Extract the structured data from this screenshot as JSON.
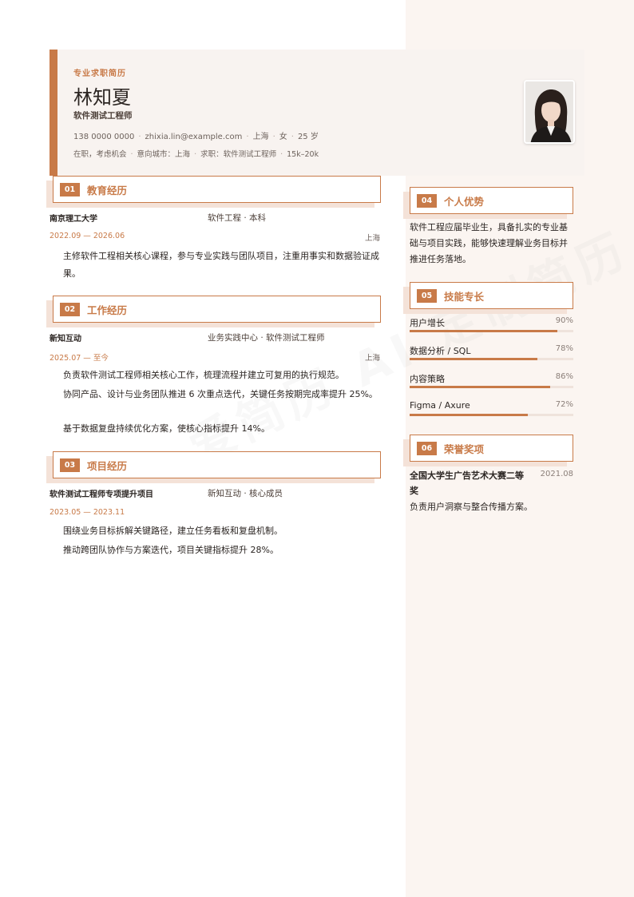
{
  "watermark": "爱简历 AI 定制简历",
  "header": {
    "tag": "专业求职简历",
    "name": "林知夏",
    "role": "软件测试工程师",
    "contact": [
      "138 0000 0000",
      "zhixia.lin@example.com",
      "上海",
      "女",
      "25 岁"
    ],
    "intent": [
      "在职，考虑机会",
      "意向城市：上海",
      "求职：软件测试工程师",
      "15k–20k"
    ]
  },
  "sections": {
    "education": {
      "num": "01",
      "title": "教育经历"
    },
    "work": {
      "num": "02",
      "title": "工作经历"
    },
    "projects": {
      "num": "03",
      "title": "项目经历"
    },
    "advantages": {
      "num": "04",
      "title": "个人优势"
    },
    "skills": {
      "num": "05",
      "title": "技能专长"
    },
    "awards": {
      "num": "06",
      "title": "荣誉奖项"
    }
  },
  "education": {
    "school": "南京理工大学",
    "major": "软件工程 · 本科",
    "dates": "2022.09 — 2026.06",
    "location": "上海",
    "bullets": [
      "主修软件工程相关核心课程，参与专业实践与团队项目，注重用事实和数据验证成果。"
    ]
  },
  "work": {
    "company": "新知互动",
    "position": "业务实践中心 · 软件测试工程师",
    "dates": "2025.07 — 至今",
    "location": "上海",
    "bullets": [
      "负责软件测试工程师相关核心工作，梳理流程并建立可复用的执行规范。",
      "协同产品、设计与业务团队推进 6 次重点迭代，关键任务按期完成率提升 25%。",
      "基于数据复盘持续优化方案，使核心指标提升 14%。"
    ]
  },
  "project": {
    "name": "软件测试工程师专项提升项目",
    "role": "新知互动 · 核心成员",
    "dates": "2023.05 — 2023.11",
    "bullets": [
      "围绕业务目标拆解关键路径，建立任务看板和复盘机制。",
      "推动跨团队协作与方案迭代，项目关键指标提升 28%。"
    ]
  },
  "advantages": "软件工程应届毕业生，具备扎实的专业基础与项目实践，能够快速理解业务目标并推进任务落地。",
  "skills": [
    {
      "name": "用户增长",
      "value": 90,
      "label": "90%"
    },
    {
      "name": "数据分析 / SQL",
      "value": 78,
      "label": "78%"
    },
    {
      "name": "内容策略",
      "value": 86,
      "label": "86%"
    },
    {
      "name": "Figma / Axure",
      "value": 72,
      "label": "72%"
    }
  ],
  "award": {
    "title": "全国大学生广告艺术大赛二等奖",
    "date": "2021.08",
    "desc": "负责用户洞察与整合传播方案。"
  },
  "colors": {
    "accent": "#c87a48",
    "panel": "#fbf5f1",
    "header_bg": "#f8f3f0"
  }
}
